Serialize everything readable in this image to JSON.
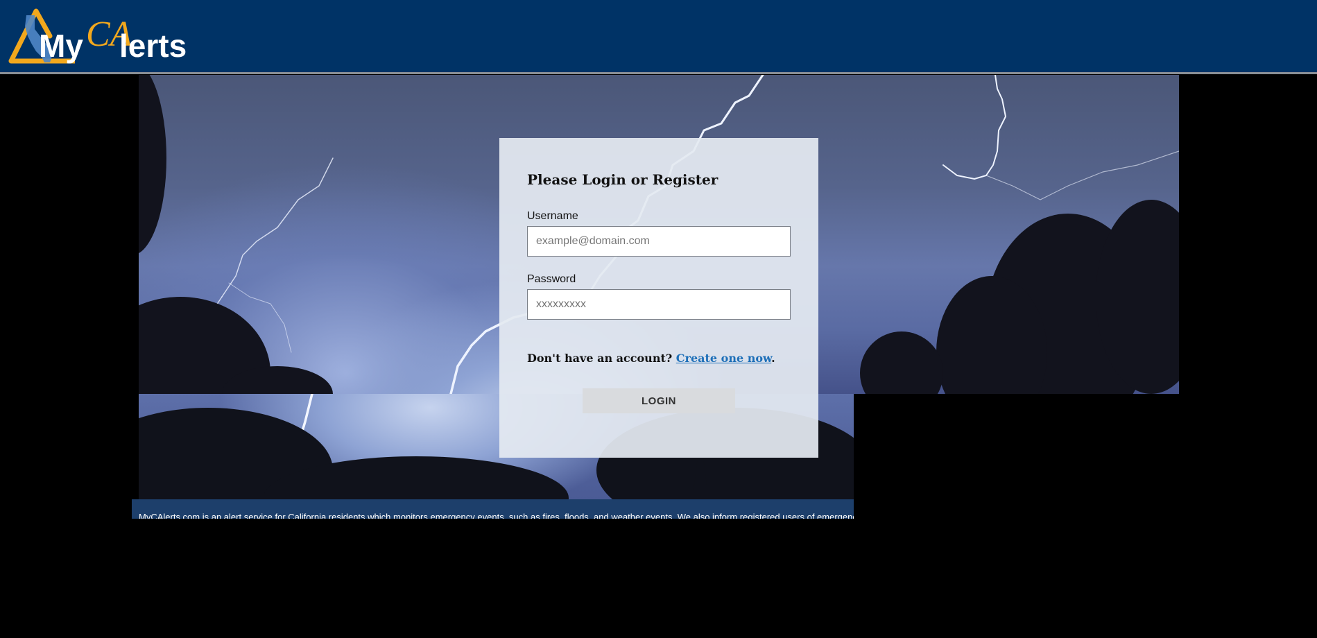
{
  "header": {
    "logo_alt": "MyCAlerts",
    "logo_text_my": "My",
    "logo_text_ca": "CA",
    "logo_text_lerts": "lerts"
  },
  "login": {
    "title": "Please Login or Register",
    "username_label": "Username",
    "username_placeholder": "example@domain.com",
    "password_label": "Password",
    "password_placeholder": "xxxxxxxxx",
    "no_account_text": "Don't have an account?",
    "create_link": "Create one now",
    "period": ".",
    "login_button": "LOGIN"
  },
  "footer": {
    "text": "MyCAlerts.com is an alert service for California residents which monitors emergency events, such as fires, floods, and weather events. We also inform registered users of emergency an"
  },
  "colors": {
    "header_bg": "#003366",
    "logo_gold": "#f2a81d",
    "logo_blue": "#4f86c6",
    "link": "#1d6fb8",
    "footer_bg": "#1d3f6b"
  }
}
